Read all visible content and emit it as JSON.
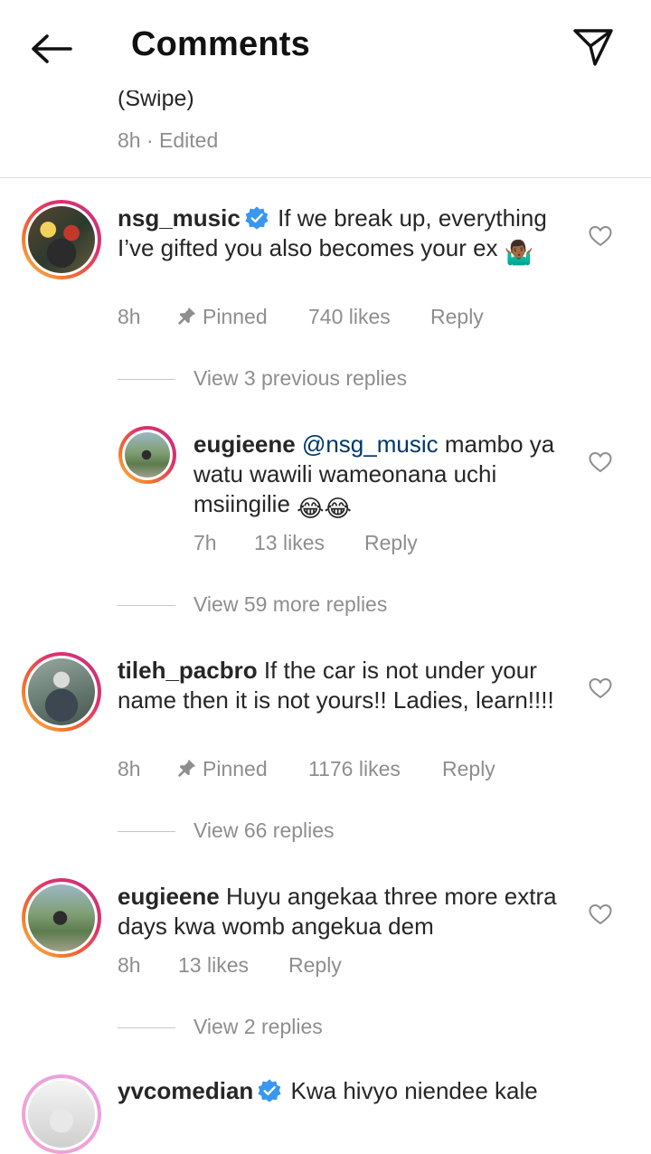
{
  "header": {
    "title": "Comments",
    "back_icon": "arrow-left-icon",
    "send_icon": "paper-plane-icon"
  },
  "caption": {
    "text": "(Swipe)",
    "time": "8h",
    "edited": "Edited",
    "separator": "·"
  },
  "comments": [
    {
      "username": "nsg_music",
      "verified": true,
      "text": "If we break up, everything I’ve gifted you also becomes your ex",
      "emoji": "🤷🏾‍♂️",
      "time": "8h",
      "pinned_label": "Pinned",
      "likes": "740 likes",
      "reply_label": "Reply",
      "view_replies": "View 3 previous replies",
      "reply": {
        "username": "eugieene",
        "mention": "@nsg_music",
        "text": "mambo ya watu wawili wameonana uchi msiingilie",
        "emoji": "😂😂",
        "time": "7h",
        "likes": "13 likes",
        "reply_label": "Reply"
      },
      "view_more": "View 59 more replies"
    },
    {
      "username": "tileh_pacbro",
      "text": "If the car is not under your name then it is not yours!! Ladies, learn!!!!",
      "time": "8h",
      "pinned_label": "Pinned",
      "likes": "1176 likes",
      "reply_label": "Reply",
      "view_replies": "View 66 replies"
    },
    {
      "username": "eugieene",
      "text": "Huyu angekaa three more extra days kwa womb angekua dem",
      "time": "8h",
      "likes": "13 likes",
      "reply_label": "Reply",
      "view_replies": "View 2 replies"
    },
    {
      "username": "yvcomedian",
      "verified": true,
      "text": "Kwa hivyo niendee kale"
    }
  ],
  "colors": {
    "text": "#262626",
    "secondary": "#8e8e8e",
    "mention": "#00376b",
    "verified": "#3897f0",
    "divider": "#dbdbdb"
  }
}
